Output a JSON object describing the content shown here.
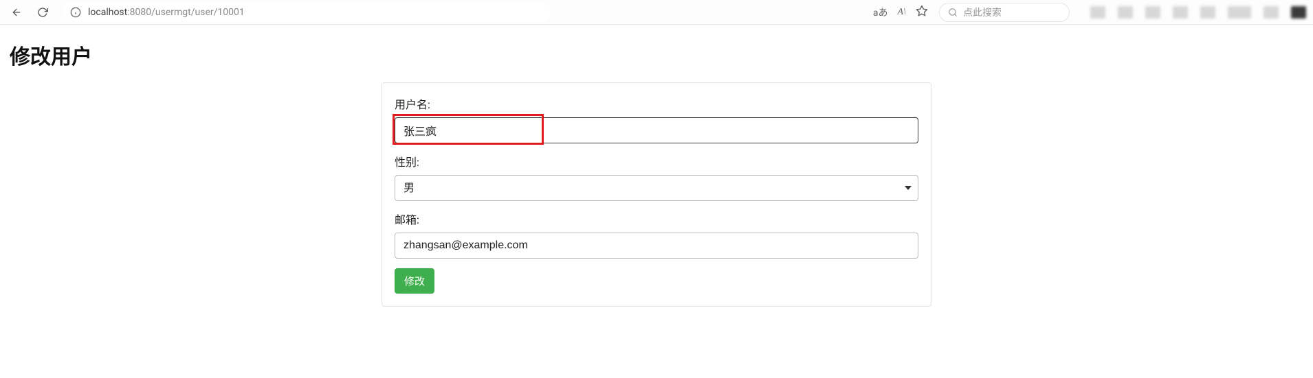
{
  "browser": {
    "url_host": "localhost",
    "url_port_path": ":8080/usermgt/user/10001",
    "translate_icon_text": "aあ",
    "reader_icon_text": "A\\",
    "search_placeholder": "点此搜索"
  },
  "page": {
    "title": "修改用户"
  },
  "form": {
    "username": {
      "label": "用户名:",
      "value": "张三疯"
    },
    "gender": {
      "label": "性别:",
      "value": "男"
    },
    "email": {
      "label": "邮箱:",
      "value": "zhangsan@example.com"
    },
    "submit_label": "修改"
  }
}
